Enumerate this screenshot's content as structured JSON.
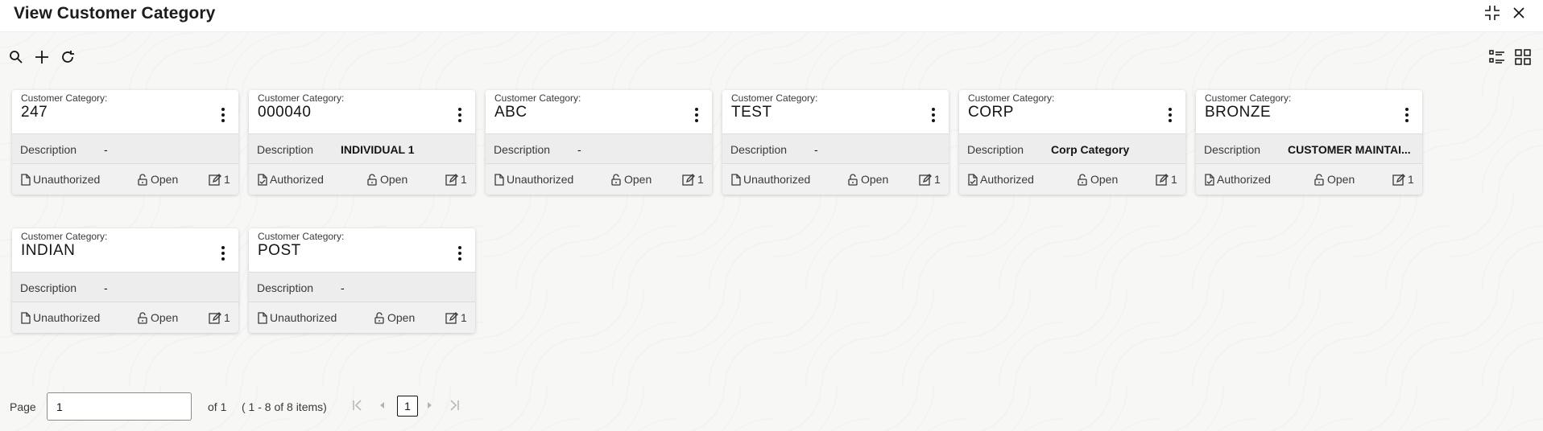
{
  "header": {
    "title": "View Customer Category",
    "minimize_icon": "collapse-icon",
    "close_icon": "close-icon"
  },
  "toolbar": {
    "search_icon": "search-icon",
    "add_icon": "plus-icon",
    "refresh_icon": "refresh-icon",
    "list_view_icon": "list-view-icon",
    "grid_view_icon": "grid-view-icon"
  },
  "labels": {
    "category": "Customer Category:",
    "description": "Description"
  },
  "cards": [
    {
      "category": "247",
      "description": "-",
      "status": "Unauthorized",
      "lock": "Open",
      "mod": "1"
    },
    {
      "category": "000040",
      "description": "INDIVIDUAL 1",
      "status": "Authorized",
      "lock": "Open",
      "mod": "1"
    },
    {
      "category": "ABC",
      "description": "-",
      "status": "Unauthorized",
      "lock": "Open",
      "mod": "1"
    },
    {
      "category": "TEST",
      "description": "-",
      "status": "Unauthorized",
      "lock": "Open",
      "mod": "1"
    },
    {
      "category": "CORP",
      "description": "Corp Category",
      "status": "Authorized",
      "lock": "Open",
      "mod": "1"
    },
    {
      "category": "BRONZE",
      "description": "CUSTOMER MAINTAI...",
      "status": "Authorized",
      "lock": "Open",
      "mod": "1"
    },
    {
      "category": "INDIAN",
      "description": "-",
      "status": "Unauthorized",
      "lock": "Open",
      "mod": "1"
    },
    {
      "category": "POST",
      "description": "-",
      "status": "Unauthorized",
      "lock": "Open",
      "mod": "1"
    }
  ],
  "pagination": {
    "page_label": "Page",
    "page_value": "1",
    "of_label": "of 1",
    "items_label": "( 1 - 8 of 8 items)",
    "current_page": "1"
  }
}
